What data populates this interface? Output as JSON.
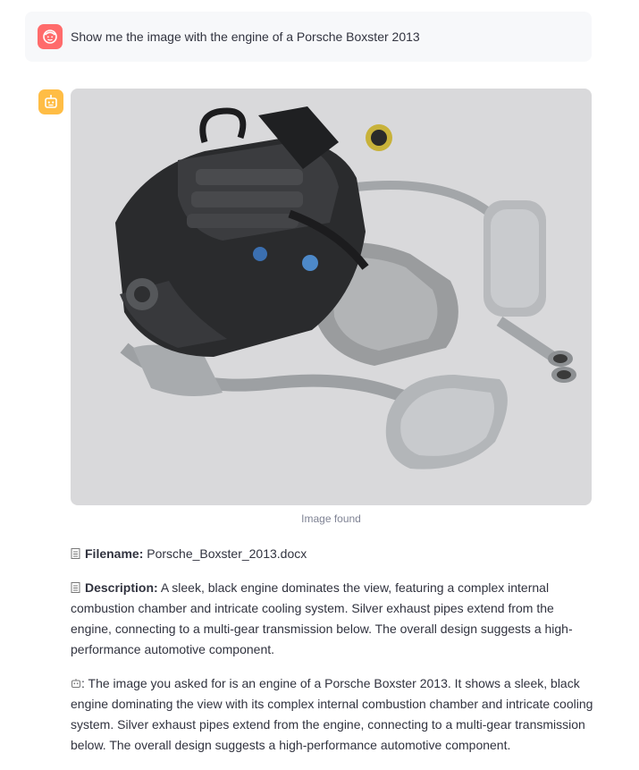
{
  "user_message": {
    "text": "Show me the image with the engine of a Porsche Boxster 2013",
    "avatar_icon": "user-face-icon",
    "avatar_color": "#ff6b6b"
  },
  "assistant": {
    "avatar_icon": "robot-icon",
    "avatar_color": "#ffbd45",
    "image_caption": "Image found",
    "filename_label": "Filename:",
    "filename_value": "Porsche_Boxster_2013.docx",
    "description_label": "Description:",
    "description_value": "A sleek, black engine dominates the view, featuring a complex internal combustion chamber and intricate cooling system. Silver exhaust pipes extend from the engine, connecting to a multi-gear transmission below. The overall design suggests a high-performance automotive component.",
    "response_text": ": The image you asked for is an engine of a Porsche Boxster 2013. It shows a sleek, black engine dominating the view with its complex internal combustion chamber and intricate cooling system. Silver exhaust pipes extend from the engine, connecting to a multi-gear transmission below. The overall design suggests a high-performance automotive component."
  }
}
